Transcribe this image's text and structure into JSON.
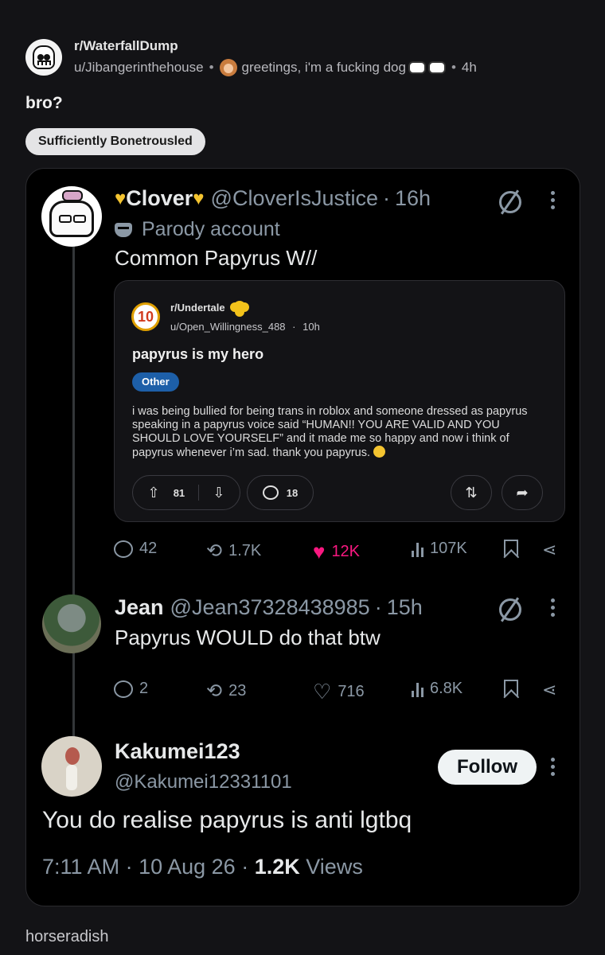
{
  "post": {
    "subreddit": "r/WaterfallDump",
    "user": "u/Jibangerinthehouse",
    "user_flair": "greetings, i'm a fucking dog",
    "time": "4h",
    "title": "bro?",
    "flair": "Sufficiently Bonetrousled",
    "footer_text": "horseradish"
  },
  "tweet1": {
    "name": "Clover",
    "handle": "@CloverIsJustice",
    "time": "16h",
    "label": "Parody account",
    "text": "Common Papyrus W//",
    "embed": {
      "subreddit": "r/Undertale",
      "icon_text": "10",
      "user": "u/Open_Willingness_488",
      "time": "10h",
      "title": "papyrus is my hero",
      "flair": "Other",
      "body": "i was being bullied for being trans in roblox and someone dressed as papyrus speaking in a papyrus voice said “HUMAN!! YOU ARE VALID AND YOU SHOULD LOVE YOURSELF” and it made me so happy and now i think of papyrus whenever i’m sad. thank you papyrus.",
      "upvotes": "81",
      "comments": "18"
    },
    "stats": {
      "replies": "42",
      "reposts": "1.7K",
      "likes": "12K",
      "views": "107K"
    }
  },
  "tweet2": {
    "name": "Jean",
    "handle": "@Jean37328438985",
    "time": "15h",
    "text": "Papyrus WOULD do that btw",
    "stats": {
      "replies": "2",
      "reposts": "23",
      "likes": "716",
      "views": "6.8K"
    }
  },
  "tweet3": {
    "name": "Kakumei123",
    "handle": "@Kakumei12331101",
    "follow_label": "Follow",
    "text": "You do realise papyrus is anti lgtbq",
    "time": "7:11 AM",
    "date": "10 Aug 26",
    "views": "1.2K",
    "views_label": "Views"
  },
  "colors": {
    "like_active": "#f91880",
    "flair_blue": "#1d5fa8",
    "muted": "#8b98a5"
  }
}
